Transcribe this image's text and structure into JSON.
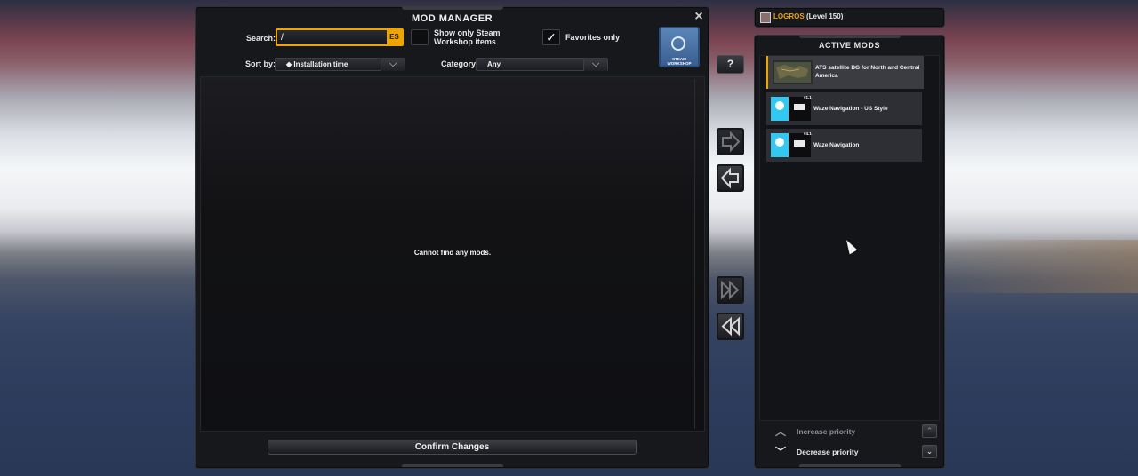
{
  "mod_manager": {
    "title": "MOD MANAGER",
    "close_icon": "×",
    "search_label": "Search:",
    "search_value": "/",
    "search_lang": "ES",
    "steam_only_label": "Show only Steam Workshop items",
    "favorites_label": "Favorites only",
    "favorites_checked": "✓",
    "sort_label": "Sort by:",
    "sort_value": "◆ Installation time",
    "category_label": "Category:",
    "category_value": "Any",
    "steam_button_text": "STEAM WORKSHOP",
    "empty_message": "Cannot find any mods.",
    "confirm_label": "Confirm Changes"
  },
  "middle": {
    "help_label": "?",
    "move_right_icon": "arrow-right-icon",
    "move_left_icon": "arrow-left-icon",
    "move_all_right_icon": "double-arrow-right-icon",
    "move_all_left_icon": "double-arrow-left-icon"
  },
  "player": {
    "name": "LOGROS",
    "level": "(Level 150)"
  },
  "active_mods": {
    "title": "ACTIVE MODS",
    "items": [
      {
        "name": "ATS satellite BG for North and Central America",
        "badge": ""
      },
      {
        "name": "Waze Navigation - US Style",
        "badge": "v1.1"
      },
      {
        "name": "Waze Navigation",
        "badge": "v4.1"
      }
    ],
    "increase_label": "Increase priority",
    "decrease_label": "Decrease priority"
  },
  "colors": {
    "accent": "#f0a400",
    "panel": "#17181c",
    "steam": "#4a73a6"
  }
}
